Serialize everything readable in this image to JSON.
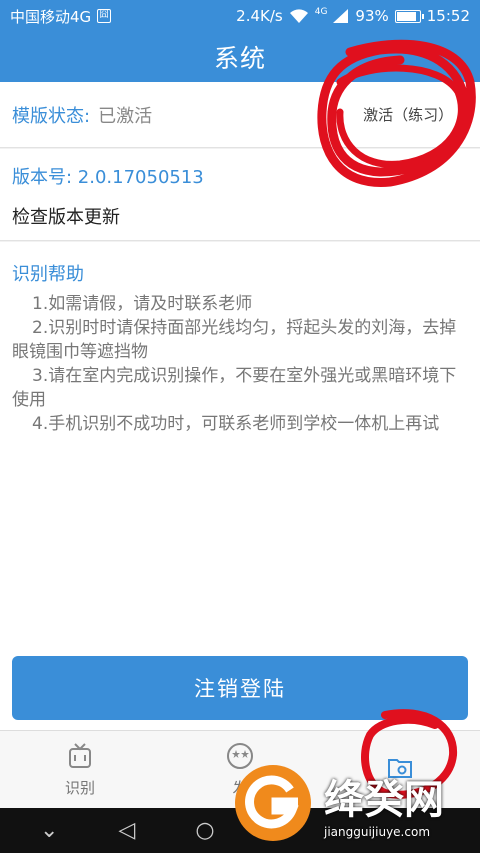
{
  "status_bar": {
    "carrier": "中国移动4G",
    "sim_badge": "囧",
    "speed": "2.4K/s",
    "network": "4G",
    "battery": "93%",
    "battery_level": 0.93,
    "time": "15:52"
  },
  "header": {
    "title": "系统"
  },
  "activation": {
    "label": "模版状态:",
    "value": "已激活",
    "link_label": "激活（练习）"
  },
  "version": {
    "label": "版本号: 2.0.17050513",
    "check_update": "检查版本更新"
  },
  "help": {
    "title": "识别帮助",
    "items": [
      "1.如需请假，请及时联系老师",
      "2.识别时时请保持面部光线均匀，捋起头发的刘海，去掉眼镜围巾等遮挡物",
      "3.请在室内完成识别操作，不要在室外强光或黑暗环境下使用",
      "4.手机识别不成功时，可联系老师到学校一体机上再试"
    ]
  },
  "logout_label": "注销登陆",
  "tabs": [
    {
      "label": "识别",
      "icon": "tv-icon"
    },
    {
      "label": "发",
      "icon": "star-face-icon"
    },
    {
      "label": "",
      "icon": "folder-gear-icon"
    }
  ],
  "watermark": {
    "main": "绛癸网",
    "sub": "jiangguijiuye.com"
  },
  "colors": {
    "accent": "#3a8ed8",
    "annotation": "#e0101e"
  }
}
